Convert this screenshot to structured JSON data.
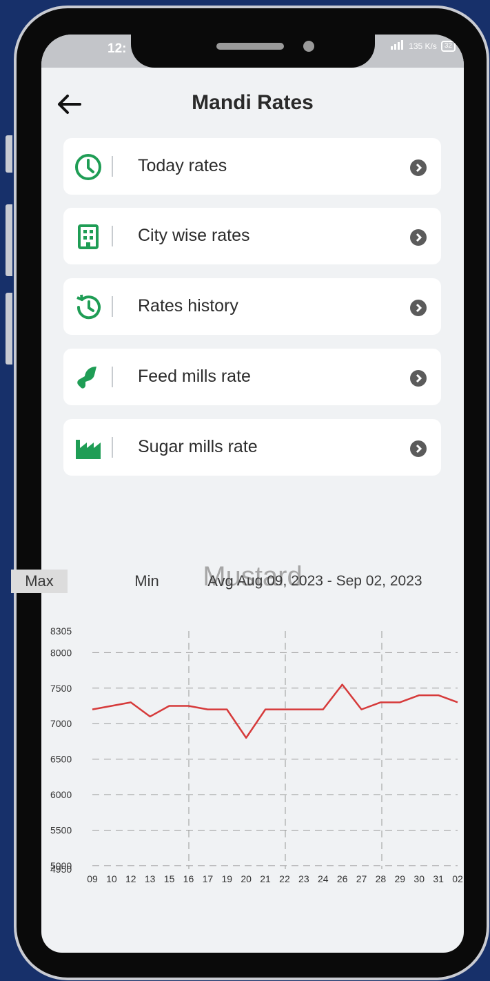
{
  "status_bar": {
    "time": "12:",
    "network_speed": "135 K/s",
    "battery": "32"
  },
  "header": {
    "title": "Mandi Rates",
    "back_icon": "arrow-left-icon"
  },
  "menu": [
    {
      "label": "Today rates",
      "icon": "clock-icon"
    },
    {
      "label": "City wise rates",
      "icon": "building-icon"
    },
    {
      "label": "Rates history",
      "icon": "history-icon"
    },
    {
      "label": "Feed mills rate",
      "icon": "feed-mill-icon"
    },
    {
      "label": "Sugar mills rate",
      "icon": "factory-icon"
    }
  ],
  "colors": {
    "accent_green": "#1f9d55",
    "line_red": "#d63a3a",
    "chevron_gray": "#5b5b5b"
  },
  "product": {
    "name": "Mustard"
  },
  "chart_tabs": {
    "max": "Max",
    "min": "Min",
    "avg": "Avg",
    "selected": "Max"
  },
  "date_range": "Aug 09, 2023 - Sep 02, 2023",
  "chart_data": {
    "type": "line",
    "title": "Mustard",
    "x": [
      "09",
      "10",
      "12",
      "13",
      "15",
      "16",
      "17",
      "19",
      "20",
      "21",
      "22",
      "23",
      "24",
      "26",
      "27",
      "28",
      "29",
      "30",
      "31",
      "02"
    ],
    "series": [
      {
        "values": [
          7200,
          7250,
          7300,
          7100,
          7250,
          7250,
          7200,
          7200,
          6800,
          7200,
          7200,
          7200,
          7200,
          7550,
          7200,
          7300,
          7300,
          7400,
          7400,
          7300
        ]
      }
    ],
    "yticks": [
      8305,
      8000,
      7500,
      7000,
      6500,
      6000,
      5500,
      5000,
      4950
    ],
    "ylim": [
      4950,
      8305
    ],
    "grid": true
  }
}
